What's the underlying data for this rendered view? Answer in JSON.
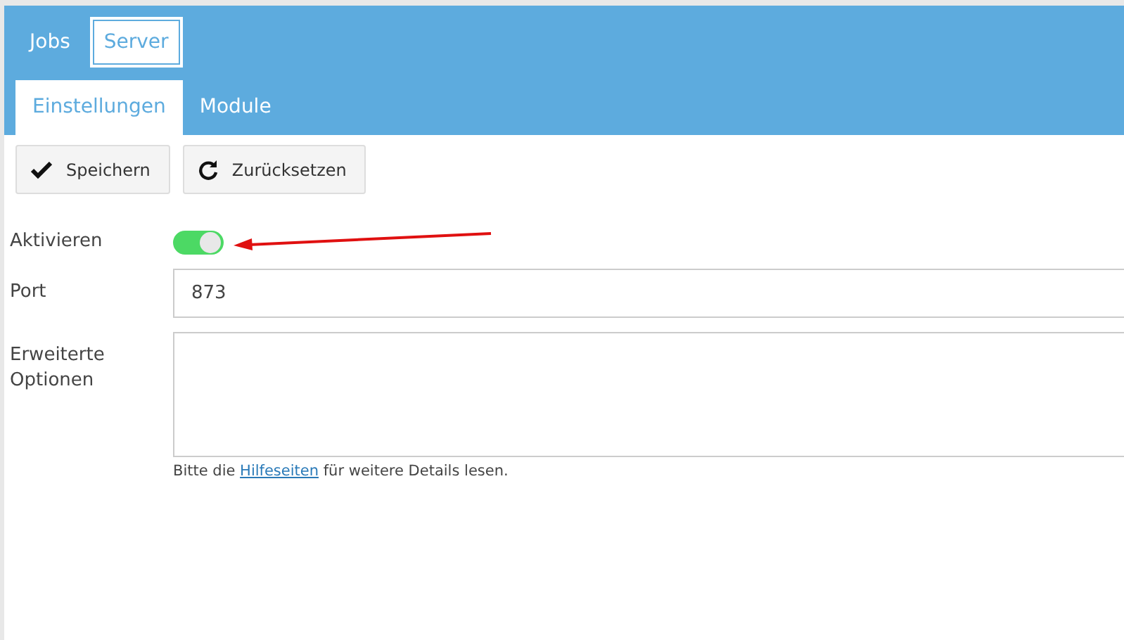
{
  "top_tabs": [
    {
      "label": "Jobs",
      "selected": false
    },
    {
      "label": "Server",
      "selected": true
    }
  ],
  "sub_tabs": [
    {
      "label": "Einstellungen",
      "selected": true
    },
    {
      "label": "Module",
      "selected": false
    }
  ],
  "buttons": [
    {
      "label": "Speichern",
      "kind": "check"
    },
    {
      "label": "Zurücksetzen",
      "kind": "reset"
    }
  ],
  "fields": [
    {
      "label": "Aktivieren",
      "kind": "toggle",
      "on": true
    },
    {
      "label": "Port",
      "kind": "input",
      "value": "873"
    },
    {
      "label": "Erweiterte Optionen",
      "kind": "textarea"
    }
  ],
  "help": {
    "before": "Bitte die ",
    "link": "Hilfeseiten",
    "after": " für weitere Details lesen."
  }
}
